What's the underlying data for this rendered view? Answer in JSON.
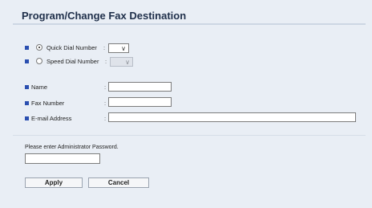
{
  "page": {
    "title": "Program/Change Fax Destination"
  },
  "destination": {
    "quick_dial_label": "Quick Dial Number",
    "speed_dial_label": "Speed Dial Number",
    "selected": "quick_dial",
    "select_arrow": "∨"
  },
  "fields": {
    "name_label": "Name",
    "fax_number_label": "Fax Number",
    "email_label": "E-mail Address",
    "colon": ":"
  },
  "password": {
    "prompt": "Please enter Administrator Password."
  },
  "buttons": {
    "apply": "Apply",
    "cancel": "Cancel"
  }
}
